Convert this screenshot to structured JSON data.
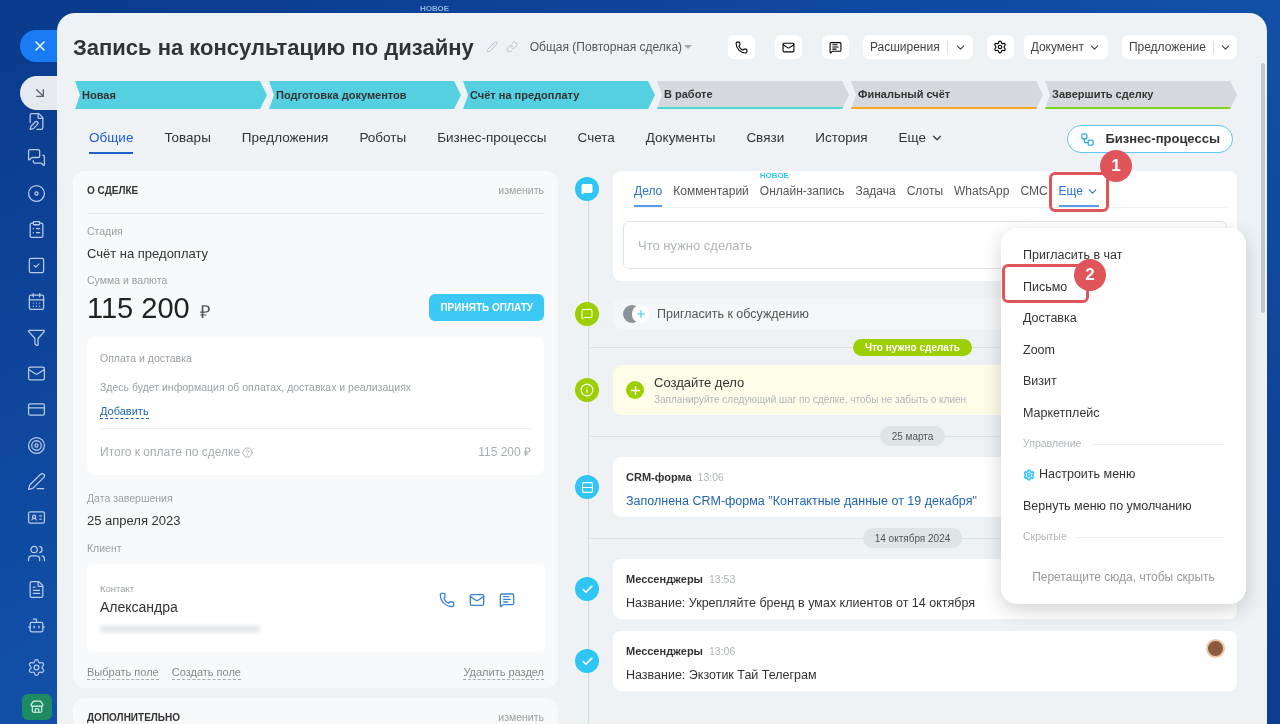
{
  "background_label": "НОВОЕ",
  "deal": {
    "title": "Запись на консультацию по дизайну",
    "category": "Общая (Повторная сделка)"
  },
  "toolbar": {
    "extensions": "Расширения",
    "document": "Документ",
    "proposal": "Предложение"
  },
  "stages": [
    {
      "label": "Новая",
      "passed": true,
      "color": "#55d0e0"
    },
    {
      "label": "Подготовка документов",
      "passed": true,
      "color": "#55d0e0"
    },
    {
      "label": "Счёт на предоплату",
      "passed": true,
      "color": "#55d0e0"
    },
    {
      "label": "В работе",
      "passed": false,
      "color": "#47d9d0"
    },
    {
      "label": "Финальный счёт",
      "passed": false,
      "color": "#f5a623"
    },
    {
      "label": "Завершить сделку",
      "passed": false,
      "color": "#7ed321"
    }
  ],
  "tabs": [
    {
      "label": "Общие",
      "selected": true,
      "kind": "tab"
    },
    {
      "label": "Товары",
      "selected": false,
      "kind": "tab"
    },
    {
      "label": "Предложения",
      "selected": false,
      "kind": "tab"
    },
    {
      "label": "Роботы",
      "selected": false,
      "kind": "tab"
    },
    {
      "label": "Бизнес-процессы",
      "selected": false,
      "kind": "tab"
    },
    {
      "label": "Счета",
      "selected": false,
      "kind": "tab"
    },
    {
      "label": "Документы",
      "selected": false,
      "kind": "tab"
    },
    {
      "label": "Связи",
      "selected": false,
      "kind": "tab"
    },
    {
      "label": "История",
      "selected": false,
      "kind": "tab"
    },
    {
      "label": "Еще",
      "selected": false,
      "kind": "more"
    }
  ],
  "bp_button": "Бизнес-процессы",
  "about": {
    "title": "О СДЕЛКЕ",
    "edit": "изменить",
    "stage_label": "Стадия",
    "stage": "Счёт на предоплату",
    "amount_label": "Сумма и валюта",
    "amount": "115 200",
    "currency": "₽",
    "pay_button": "ПРИНЯТЬ ОПЛАТУ",
    "payment": {
      "title": "Оплата и доставка",
      "text": "Здесь будет информация об оплатах, доставках и реализациях",
      "add": "Добавить",
      "total_label": "Итого к оплате по сделке",
      "total": "115 200 ₽"
    },
    "date_label": "Дата завершения",
    "date": "25 апреля 2023",
    "client_label": "Клиент",
    "contact_label": "Контакт",
    "contact": "Александра",
    "links": [
      "Выбрать поле",
      "Создать поле"
    ],
    "delete": "Удалить раздел"
  },
  "extra": {
    "title": "ДОПОЛНИТЕЛЬНО",
    "edit": "изменить"
  },
  "activity": {
    "tabs": [
      {
        "label": "Дело",
        "selected": true,
        "kind": "tab"
      },
      {
        "label": "Комментарий",
        "selected": false,
        "kind": "tab"
      },
      {
        "label": "Онлайн-запись",
        "selected": false,
        "kind": "tab",
        "badge": "НОВОЕ"
      },
      {
        "label": "Задача",
        "selected": false,
        "kind": "tab"
      },
      {
        "label": "Слоты",
        "selected": false,
        "kind": "tab"
      },
      {
        "label": "WhatsApp",
        "selected": false,
        "kind": "tab"
      },
      {
        "label": "СМС",
        "selected": false,
        "kind": "tab"
      },
      {
        "label": "Еще",
        "selected": true,
        "kind": "more"
      }
    ],
    "placeholder": "Что нужно сделать"
  },
  "invite": "Пригласить к обсуждению",
  "todo_label": "Что нужно сделать",
  "create": {
    "title": "Создайте дело",
    "text": "Запланируйте следующий шаг по сделке, чтобы не забыть о клиен"
  },
  "timeline": [
    {
      "kind": "date",
      "label": "25 марта"
    },
    {
      "kind": "form",
      "title": "CRM-форма",
      "time": "13:06",
      "text": "Заполнена CRM-форма \"Контактные данные от 19 декабря\""
    },
    {
      "kind": "date",
      "label": "14 октября 2024"
    },
    {
      "kind": "message",
      "title": "Мессенджеры",
      "time": "13:53",
      "text": "Название: Укрепляйте бренд в умах клиентов от 14 октября"
    },
    {
      "kind": "message",
      "title": "Мессенджеры",
      "time": "13:06",
      "text": "Название: Экзотик Тай Телеграм",
      "avatar": true
    }
  ],
  "menu": [
    {
      "kind": "item",
      "label": "Пригласить в чат"
    },
    {
      "kind": "item",
      "label": "Письмо"
    },
    {
      "kind": "item",
      "label": "Доставка"
    },
    {
      "kind": "item",
      "label": "Zoom"
    },
    {
      "kind": "item",
      "label": "Визит"
    },
    {
      "kind": "item",
      "label": "Маркетплейс"
    },
    {
      "kind": "section",
      "label": "Управление"
    },
    {
      "kind": "settings",
      "label": "Настроить меню"
    },
    {
      "kind": "item",
      "label": "Вернуть меню по умолчанию"
    },
    {
      "kind": "section",
      "label": "Скрытые"
    },
    {
      "kind": "hint",
      "label": "Перетащите сюда, чтобы скрыть"
    }
  ],
  "callouts": [
    {
      "number": "1"
    },
    {
      "number": "2"
    }
  ]
}
